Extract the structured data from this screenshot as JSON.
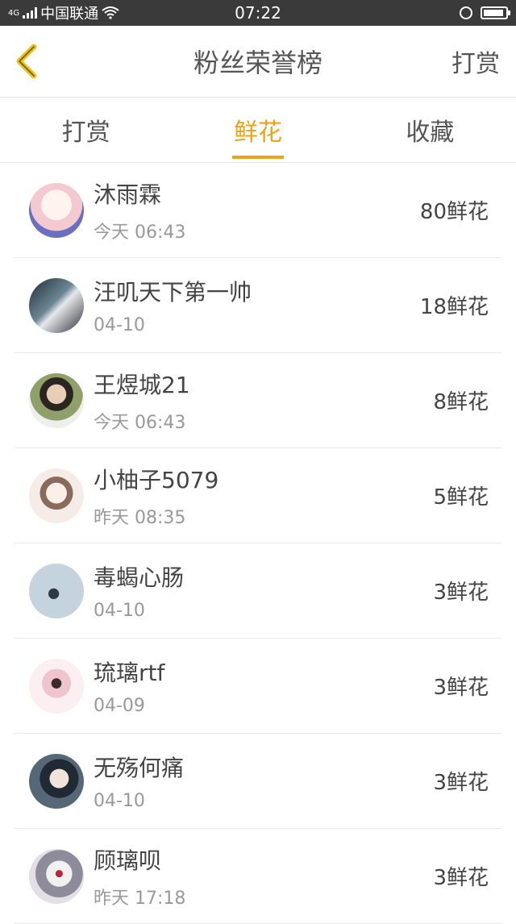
{
  "status": {
    "carrier": "中国联通",
    "net": "4G",
    "time": "07:22"
  },
  "nav": {
    "title": "粉丝荣誉榜",
    "action": "打赏"
  },
  "tabs": [
    {
      "label": "打赏"
    },
    {
      "label": "鲜花"
    },
    {
      "label": "收藏"
    }
  ],
  "rows": [
    {
      "name": "沐雨霖",
      "time": "今天 06:43",
      "amount": "80鲜花",
      "avatar_color": "#f4d6d6"
    },
    {
      "name": "汪叽天下第一帅",
      "time": "04-10",
      "amount": "18鲜花",
      "avatar_color": "#5b6c78"
    },
    {
      "name": "王煜城21",
      "time": "今天 06:43",
      "amount": "8鲜花",
      "avatar_color": "#8a9a6a"
    },
    {
      "name": "小柚子5079",
      "time": "昨天 08:35",
      "amount": "5鲜花",
      "avatar_color": "#efe3de"
    },
    {
      "name": "毒蝎心肠",
      "time": "04-10",
      "amount": "3鲜花",
      "avatar_color": "#b9c9d6"
    },
    {
      "name": "琉璃rtf",
      "time": "04-09",
      "amount": "3鲜花",
      "avatar_color": "#f1dfe4"
    },
    {
      "name": "无殇何痛",
      "time": "04-10",
      "amount": "3鲜花",
      "avatar_color": "#3c4a5a"
    },
    {
      "name": "顾璃呗",
      "time": "昨天 17:18",
      "amount": "3鲜花",
      "avatar_color": "#c9c3c8"
    }
  ]
}
